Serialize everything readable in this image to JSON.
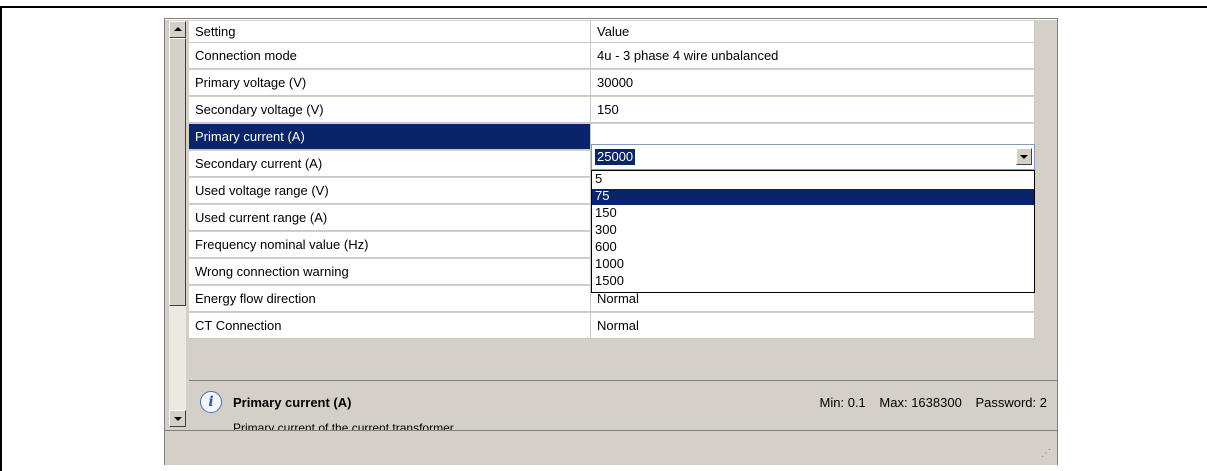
{
  "grid": {
    "headers": [
      "Setting",
      "Value"
    ],
    "rows": [
      {
        "setting": "Connection mode",
        "value": "4u - 3 phase 4 wire unbalanced"
      },
      {
        "setting": "Primary voltage (V)",
        "value": "30000"
      },
      {
        "setting": "Secondary voltage (V)",
        "value": "150"
      },
      {
        "setting": "Primary current (A)",
        "value": ""
      },
      {
        "setting": "Secondary current (A)",
        "value": ""
      },
      {
        "setting": "Used voltage range (V)",
        "value": ""
      },
      {
        "setting": "Used current range (A)",
        "value": ""
      },
      {
        "setting": "Frequency nominal value (Hz)",
        "value": ""
      },
      {
        "setting": "Wrong connection warning",
        "value": ""
      },
      {
        "setting": "Energy flow direction",
        "value": "Normal"
      },
      {
        "setting": "CT Connection",
        "value": "Normal"
      }
    ]
  },
  "editor": {
    "current_value": "25000",
    "options": [
      "5",
      "75",
      "150",
      "300",
      "600",
      "1000",
      "1500"
    ],
    "highlighted": "75"
  },
  "info": {
    "title": "Primary current (A)",
    "description": "Primary current of the current transformer.",
    "min": "Min: 0.1",
    "max": "Max: 1638300",
    "password": "Password: 2",
    "icon": "info-icon"
  },
  "colors": {
    "selection": "#0a246a",
    "panel": "#d4d0c8"
  }
}
